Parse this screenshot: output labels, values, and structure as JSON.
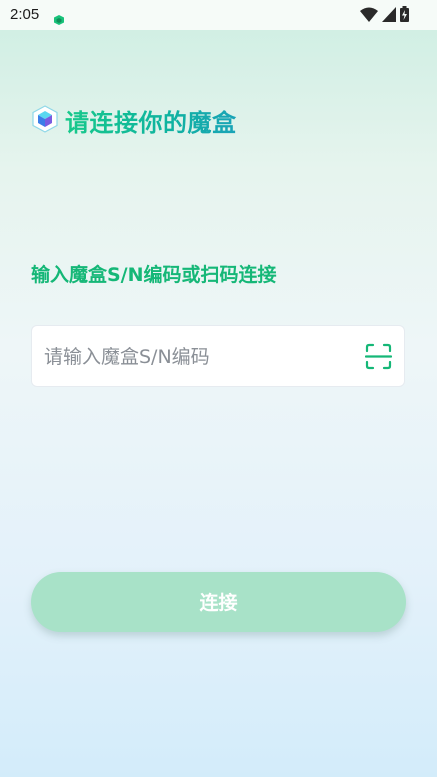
{
  "status_bar": {
    "time": "2:05",
    "icons": [
      "app-notification-icon",
      "wifi-icon",
      "cellular-signal-icon",
      "battery-charging-icon"
    ]
  },
  "header": {
    "title": "请连接你的魔盒",
    "logo_icon": "cube-icon"
  },
  "form": {
    "label": "输入魔盒S/N编码或扫码连接",
    "sn_input": {
      "value": "",
      "placeholder": "请输入魔盒S/N编码"
    },
    "scan_icon": "scan-icon"
  },
  "actions": {
    "connect_label": "连接"
  },
  "colors": {
    "accent": "#15b777",
    "button_disabled": "#a8e2c8"
  }
}
